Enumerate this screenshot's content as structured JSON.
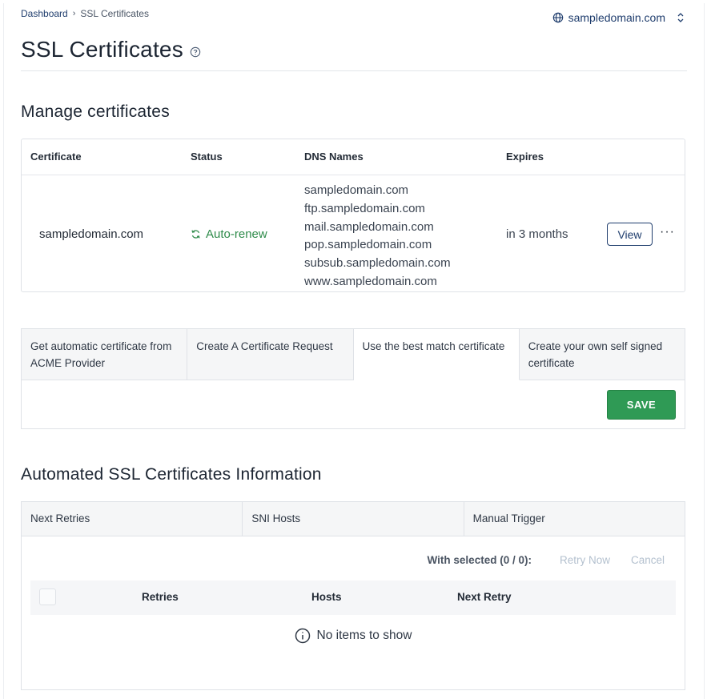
{
  "breadcrumb": {
    "home": "Dashboard",
    "current": "SSL Certificates"
  },
  "domain_switcher": {
    "value": "sampledomain.com"
  },
  "page": {
    "title": "SSL Certificates"
  },
  "manage": {
    "heading": "Manage certificates",
    "columns": {
      "certificate": "Certificate",
      "status": "Status",
      "dns": "DNS Names",
      "expires": "Expires"
    },
    "row": {
      "certificate": "sampledomain.com",
      "status": "Auto-renew",
      "dns": [
        "sampledomain.com",
        "ftp.sampledomain.com",
        "mail.sampledomain.com",
        "pop.sampledomain.com",
        "subsub.sampledomain.com",
        "www.sampledomain.com"
      ],
      "expires": "in 3 months",
      "view_label": "View",
      "more_label": "···"
    }
  },
  "options": {
    "tabs": [
      "Get automatic certificate from ACME Provider",
      "Create A Certificate Request",
      "Use the best match certificate",
      "Create your own self signed certificate"
    ],
    "active_index": 2,
    "save_label": "SAVE"
  },
  "automated": {
    "heading": "Automated SSL Certificates Information",
    "tabs": [
      "Next Retries",
      "SNI Hosts",
      "Manual Trigger"
    ],
    "with_selected": "With selected (0 / 0):",
    "retry_now": "Retry Now",
    "cancel": "Cancel",
    "columns": {
      "retries": "Retries",
      "hosts": "Hosts",
      "next_retry": "Next Retry"
    },
    "empty_text": "No items to show"
  },
  "colors": {
    "accent": "#1f3d6d",
    "success": "#2f9a55",
    "status_green": "#2e8b4a"
  },
  "icons": {
    "domain": "globe-icon",
    "switch": "chevron-up-down-icon",
    "help": "help-circle-icon",
    "status": "refresh-icon",
    "empty": "info-circle-icon"
  }
}
